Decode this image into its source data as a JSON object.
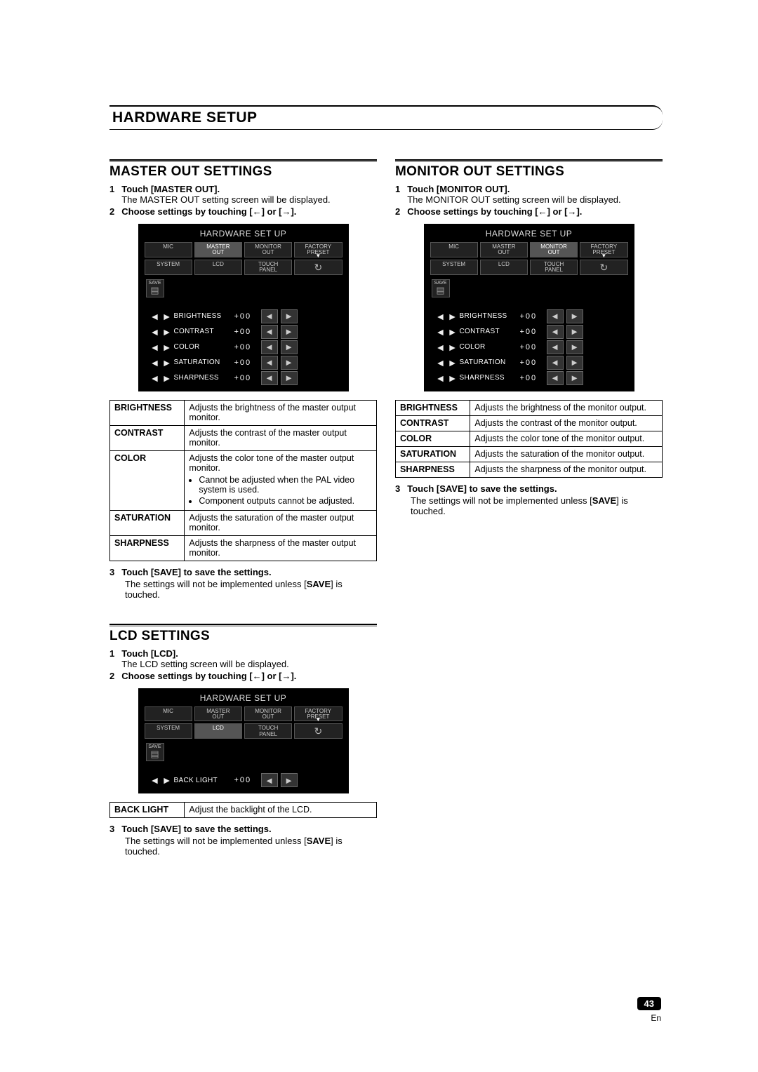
{
  "page_header": "HARDWARE SETUP",
  "page_number": "43",
  "lang": "En",
  "panel": {
    "title": "HARDWARE SET UP",
    "tabs_row1": [
      "MIC",
      "MASTER\nOUT",
      "MONITOR\nOUT",
      "FACTORY\nPRESET"
    ],
    "tabs_row2": [
      "SYSTEM",
      "LCD",
      "TOUCH\nPANEL"
    ],
    "save_label": "SAVE",
    "value": "+00",
    "settings5": [
      "BRIGHTNESS",
      "CONTRAST",
      "COLOR",
      "SATURATION",
      "SHARPNESS"
    ],
    "settings1": [
      "BACK LIGHT"
    ]
  },
  "master": {
    "title": "MASTER OUT SETTINGS",
    "step1_bold": "Touch [MASTER OUT].",
    "step1_desc": "The MASTER OUT setting screen will be displayed.",
    "step2_a": "Choose settings by touching [",
    "step2_b": "] or [",
    "step2_c": "].",
    "spec": [
      {
        "k": "BRIGHTNESS",
        "v": "Adjusts the brightness of the master output monitor."
      },
      {
        "k": "CONTRAST",
        "v": "Adjusts the contrast of the master output monitor."
      },
      {
        "k": "COLOR",
        "v": "Adjusts the color tone of the master output monitor.",
        "bullets": [
          "Cannot be adjusted when the PAL video system is used.",
          "Component outputs cannot be adjusted."
        ]
      },
      {
        "k": "SATURATION",
        "v": "Adjusts the saturation of the master output monitor."
      },
      {
        "k": "SHARPNESS",
        "v": "Adjusts the sharpness of the master output monitor."
      }
    ],
    "step3_bold": "Touch [SAVE] to save the settings.",
    "step3_desc_a": "The settings will not be implemented unless [",
    "step3_desc_b": "SAVE",
    "step3_desc_c": "] is touched."
  },
  "monitor": {
    "title": "MONITOR OUT SETTINGS",
    "step1_bold": "Touch [MONITOR OUT].",
    "step1_desc": "The MONITOR OUT setting screen will be displayed.",
    "step2_a": "Choose settings by touching [",
    "step2_b": "] or [",
    "step2_c": "].",
    "spec": [
      {
        "k": "BRIGHTNESS",
        "v": "Adjusts the brightness of the monitor output."
      },
      {
        "k": "CONTRAST",
        "v": "Adjusts the contrast of the monitor output."
      },
      {
        "k": "COLOR",
        "v": "Adjusts the color tone of the monitor output."
      },
      {
        "k": "SATURATION",
        "v": "Adjusts the saturation of the monitor output."
      },
      {
        "k": "SHARPNESS",
        "v": "Adjusts the sharpness of the monitor output."
      }
    ],
    "step3_bold": "Touch [SAVE] to save the settings.",
    "step3_desc_a": "The settings will not be implemented unless [",
    "step3_desc_b": "SAVE",
    "step3_desc_c": "] is touched."
  },
  "lcd": {
    "title": "LCD SETTINGS",
    "step1_bold": "Touch [LCD].",
    "step1_desc": "The LCD setting screen will be displayed.",
    "step2_a": "Choose settings by touching [",
    "step2_b": "] or [",
    "step2_c": "].",
    "spec": [
      {
        "k": "BACK LIGHT",
        "v": "Adjust the backlight of the LCD."
      }
    ],
    "step3_bold": "Touch [SAVE] to save the settings.",
    "step3_desc_a": "The settings will not be implemented unless [",
    "step3_desc_b": "SAVE",
    "step3_desc_c": "] is touched."
  }
}
